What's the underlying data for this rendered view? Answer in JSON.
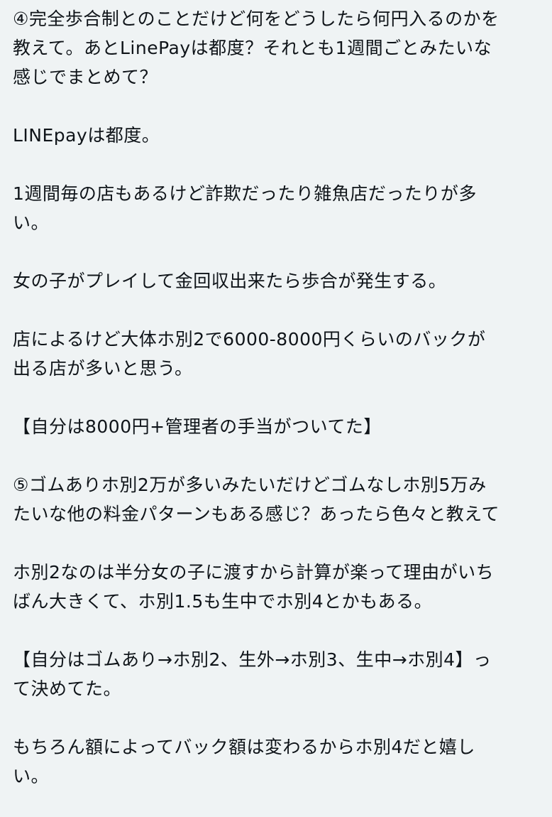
{
  "post": {
    "paragraphs": [
      {
        "lines": [
          "④完全歩合制とのことだけど何をどうしたら何円入るのかを",
          "教えて。あとLinePayは都度？それとも1週間ごとみたいな",
          "感じでまとめて？"
        ]
      },
      {
        "lines": [
          "LINEpayは都度。"
        ]
      },
      {
        "lines": [
          "1週間毎の店もあるけど詐欺だったり雑魚店だったりが多",
          "い。"
        ]
      },
      {
        "lines": [
          "女の子がプレイして金回収出来たら歩合が発生する。"
        ]
      },
      {
        "lines": [
          "店によるけど大体ホ別2で6000-8000円くらいのバックが",
          "出る店が多いと思う。"
        ]
      },
      {
        "lines": [
          "【自分は8000円+管理者の手当がついてた】"
        ]
      },
      {
        "lines": [
          "⑤ゴムありホ別2万が多いみたいだけどゴムなしホ別5万み",
          "たいな他の料金パターンもある感じ？あったら色々と教えて"
        ]
      },
      {
        "lines": [
          "ホ別2なのは半分女の子に渡すから計算が楽って理由がいち",
          "ばん大きくて、ホ別1.5も生中でホ別4とかもある。"
        ]
      },
      {
        "lines": [
          "【自分はゴムあり→ホ別2、生外→ホ別3、生中→ホ別4】っ",
          "て決めてた。"
        ]
      },
      {
        "lines": [
          "もちろん額によってバック額は変わるからホ別4だと嬉し",
          "い。"
        ]
      }
    ]
  }
}
